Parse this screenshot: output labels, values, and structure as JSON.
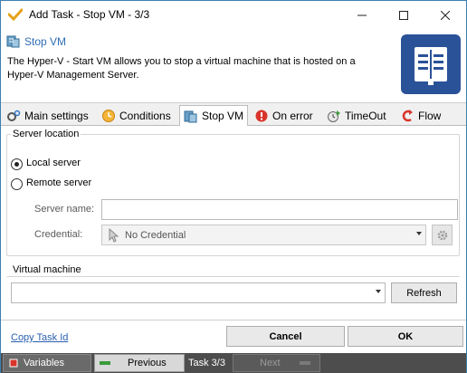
{
  "window": {
    "title": "Add Task - Stop VM - 3/3",
    "icon": "app-check-icon",
    "controls": {
      "minimize": "—",
      "maximize": "☐",
      "close": "✕"
    }
  },
  "header": {
    "title": "Stop VM",
    "description": "The Hyper-V - Start VM allows you to stop a virtual machine that is hosted on a Hyper-V Management Server.",
    "logo": "document-book-icon",
    "accent": "#2a5298"
  },
  "tabs": [
    {
      "label": "Main settings",
      "icon": "gears-icon"
    },
    {
      "label": "Conditions",
      "icon": "clock-icon"
    },
    {
      "label": "Stop VM",
      "icon": "server-icon",
      "active": true
    },
    {
      "label": "On error",
      "icon": "error-icon"
    },
    {
      "label": "TimeOut",
      "icon": "timeout-icon"
    },
    {
      "label": "Flow",
      "icon": "flow-icon"
    }
  ],
  "server_location": {
    "legend": "Server location",
    "local_label": "Local server",
    "remote_label": "Remote server",
    "selected": "local",
    "server_name_label": "Server name:",
    "server_name_value": "",
    "credential_label": "Credential:",
    "credential_value": "No Credential"
  },
  "virtual_machine": {
    "legend": "Virtual machine",
    "value": "",
    "refresh_label": "Refresh"
  },
  "footer": {
    "copy_link": "Copy Task Id",
    "cancel_label": "Cancel",
    "ok_label": "OK"
  },
  "bottombar": {
    "variables_label": "Variables",
    "previous_label": "Previous",
    "task_counter": "Task 3/3",
    "next_label": "Next"
  }
}
